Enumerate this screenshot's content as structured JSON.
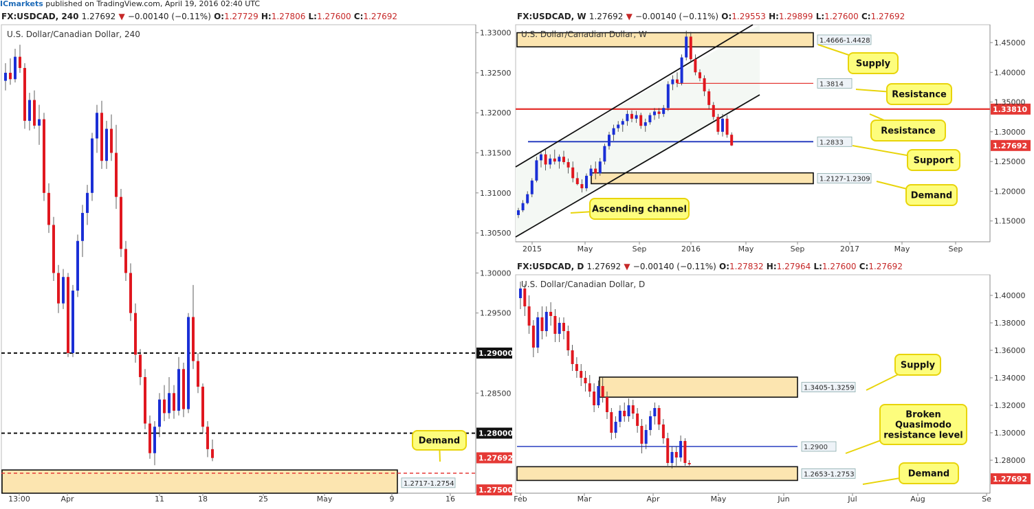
{
  "header": {
    "brand": "ICmarkets",
    "published": " published on TradingView.com, April 19, 2016 02:40 UTC"
  },
  "panels": {
    "h4": {
      "symbol": "FX:USDCAD, 240",
      "last": "1.27692",
      "change": "−0.00140 (−0.11%)",
      "o": "1.27729",
      "h": "1.27806",
      "l": "1.27600",
      "c": "1.27692",
      "chart_title": "U.S. Dollar/Canadian Dollar, 240"
    },
    "weekly": {
      "symbol": "FX:USDCAD, W",
      "last": "1.27692",
      "change": "−0.00140 (−0.11%)",
      "o": "1.29553",
      "h": "1.29899",
      "l": "1.27600",
      "c": "1.27692",
      "chart_title": "U.S. Dollar/Canadian Dollar, W"
    },
    "daily": {
      "symbol": "FX:USDCAD, D",
      "last": "1.27692",
      "change": "−0.00140 (−0.11%)",
      "o": "1.27832",
      "h": "1.27964",
      "l": "1.27600",
      "c": "1.27692",
      "chart_title": "U.S. Dollar/Canadian Dollar, D"
    }
  },
  "colors": {
    "up": "#1a2fd6",
    "down": "#e0171f",
    "zone_fill": "#fce5b0",
    "callout": "#fdfd7d",
    "callout_border": "#e8d40a",
    "res_line": "#e53935",
    "sup_line": "#283fc0"
  },
  "chart_data": [
    {
      "id": "h4",
      "type": "candlestick",
      "title": "U.S. Dollar/Canadian Dollar, 240",
      "ylim": [
        1.2725,
        1.331
      ],
      "y_ticks": [
        "1.33000",
        "1.32500",
        "1.32000",
        "1.31500",
        "1.31000",
        "1.30500",
        "1.30000",
        "1.29500",
        "1.29000",
        "1.28500",
        "1.28000",
        "1.27692",
        "1.27500"
      ],
      "x_ticks": [
        "13:00",
        "Apr",
        "11",
        "18",
        "25",
        "May",
        "9",
        "16"
      ],
      "ohlc": [
        [
          1.324,
          1.3262,
          1.3228,
          1.325
        ],
        [
          1.325,
          1.3268,
          1.3235,
          1.3242
        ],
        [
          1.3242,
          1.328,
          1.3238,
          1.327
        ],
        [
          1.327,
          1.3285,
          1.325,
          1.3256
        ],
        [
          1.3256,
          1.3262,
          1.318,
          1.319
        ],
        [
          1.319,
          1.3225,
          1.3178,
          1.3216
        ],
        [
          1.3216,
          1.3228,
          1.318,
          1.3184
        ],
        [
          1.3184,
          1.321,
          1.316,
          1.3192
        ],
        [
          1.3192,
          1.32,
          1.309,
          1.31
        ],
        [
          1.31,
          1.3112,
          1.305,
          1.306
        ],
        [
          1.306,
          1.307,
          1.299,
          1.3
        ],
        [
          1.3,
          1.301,
          1.295,
          1.2962
        ],
        [
          1.2962,
          1.3005,
          1.2955,
          1.2995
        ],
        [
          1.2995,
          1.3,
          1.2895,
          1.29
        ],
        [
          1.29,
          1.2985,
          1.2895,
          1.2978
        ],
        [
          1.2978,
          1.3048,
          1.297,
          1.304
        ],
        [
          1.304,
          1.3085,
          1.302,
          1.3075
        ],
        [
          1.3075,
          1.311,
          1.306,
          1.31
        ],
        [
          1.31,
          1.3175,
          1.309,
          1.3168
        ],
        [
          1.3168,
          1.321,
          1.315,
          1.32
        ],
        [
          1.32,
          1.3215,
          1.313,
          1.314
        ],
        [
          1.314,
          1.319,
          1.313,
          1.318
        ],
        [
          1.318,
          1.3198,
          1.314,
          1.315
        ],
        [
          1.315,
          1.3185,
          1.308,
          1.3095
        ],
        [
          1.3095,
          1.3105,
          1.302,
          1.303
        ],
        [
          1.303,
          1.304,
          1.299,
          1.3
        ],
        [
          1.3,
          1.3012,
          1.294,
          1.295
        ],
        [
          1.295,
          1.2962,
          1.2888,
          1.2898
        ],
        [
          1.2898,
          1.2905,
          1.286,
          1.287
        ],
        [
          1.287,
          1.288,
          1.2805,
          1.2812
        ],
        [
          1.2812,
          1.2822,
          1.2768,
          1.2775
        ],
        [
          1.2775,
          1.2815,
          1.276,
          1.2808
        ],
        [
          1.2808,
          1.285,
          1.2795,
          1.2842
        ],
        [
          1.2842,
          1.286,
          1.2815,
          1.2825
        ],
        [
          1.2825,
          1.287,
          1.2818,
          1.285
        ],
        [
          1.285,
          1.286,
          1.2818,
          1.2828
        ],
        [
          1.2828,
          1.2895,
          1.2822,
          1.288
        ],
        [
          1.288,
          1.2888,
          1.282,
          1.283
        ],
        [
          1.283,
          1.295,
          1.2825,
          1.2945
        ],
        [
          1.2945,
          1.2985,
          1.288,
          1.289
        ],
        [
          1.289,
          1.29,
          1.285,
          1.2858
        ],
        [
          1.2858,
          1.2862,
          1.28,
          1.2808
        ],
        [
          1.2808,
          1.2815,
          1.277,
          1.278
        ],
        [
          1.278,
          1.2792,
          1.2765,
          1.2769
        ]
      ],
      "levels": [
        {
          "price": 1.29,
          "label": "1.29000",
          "style": "dashed"
        },
        {
          "price": 1.28,
          "label": "1.28000",
          "style": "dashed"
        },
        {
          "price": 1.275,
          "label": "1.27500",
          "style": "dashed-red"
        }
      ],
      "zones": [
        {
          "from": 1.2717,
          "to": 1.2754,
          "label": "1.2717-1.2754"
        }
      ],
      "callouts": [
        "Demand"
      ]
    },
    {
      "id": "weekly",
      "type": "candlestick",
      "title": "U.S. Dollar/Canadian Dollar, W",
      "ylim": [
        1.115,
        1.48
      ],
      "y_ticks": [
        "1.45000",
        "1.40000",
        "1.35000",
        "1.30000",
        "1.25000",
        "1.20000",
        "1.15000"
      ],
      "price_labels": [
        "1.33810",
        "1.27692"
      ],
      "x_ticks": [
        "2015",
        "May",
        "Sep",
        "2016",
        "May",
        "Sep",
        "2017",
        "May",
        "Sep"
      ],
      "ohlc": [
        [
          1.16,
          1.172,
          1.155,
          1.168
        ],
        [
          1.168,
          1.185,
          1.165,
          1.18
        ],
        [
          1.18,
          1.2,
          1.178,
          1.195
        ],
        [
          1.195,
          1.222,
          1.19,
          1.218
        ],
        [
          1.218,
          1.258,
          1.215,
          1.252
        ],
        [
          1.252,
          1.268,
          1.24,
          1.262
        ],
        [
          1.262,
          1.27,
          1.235,
          1.245
        ],
        [
          1.245,
          1.262,
          1.238,
          1.255
        ],
        [
          1.255,
          1.27,
          1.245,
          1.25
        ],
        [
          1.25,
          1.262,
          1.238,
          1.258
        ],
        [
          1.258,
          1.268,
          1.245,
          1.249
        ],
        [
          1.249,
          1.255,
          1.23,
          1.24
        ],
        [
          1.24,
          1.25,
          1.215,
          1.222
        ],
        [
          1.222,
          1.232,
          1.21,
          1.212
        ],
        [
          1.212,
          1.22,
          1.198,
          1.205
        ],
        [
          1.205,
          1.23,
          1.2,
          1.226
        ],
        [
          1.226,
          1.244,
          1.22,
          1.238
        ],
        [
          1.238,
          1.25,
          1.22,
          1.23
        ],
        [
          1.23,
          1.256,
          1.226,
          1.25
        ],
        [
          1.25,
          1.28,
          1.245,
          1.276
        ],
        [
          1.276,
          1.3,
          1.27,
          1.295
        ],
        [
          1.295,
          1.312,
          1.285,
          1.306
        ],
        [
          1.306,
          1.318,
          1.3,
          1.312
        ],
        [
          1.312,
          1.322,
          1.3,
          1.318
        ],
        [
          1.318,
          1.336,
          1.31,
          1.33
        ],
        [
          1.33,
          1.336,
          1.316,
          1.322
        ],
        [
          1.322,
          1.335,
          1.315,
          1.328
        ],
        [
          1.328,
          1.332,
          1.305,
          1.31
        ],
        [
          1.31,
          1.322,
          1.3,
          1.316
        ],
        [
          1.316,
          1.332,
          1.312,
          1.328
        ],
        [
          1.328,
          1.34,
          1.32,
          1.334
        ],
        [
          1.334,
          1.34,
          1.322,
          1.33
        ],
        [
          1.33,
          1.345,
          1.325,
          1.34
        ],
        [
          1.34,
          1.385,
          1.335,
          1.38
        ],
        [
          1.38,
          1.395,
          1.37,
          1.388
        ],
        [
          1.388,
          1.4,
          1.375,
          1.382
        ],
        [
          1.382,
          1.43,
          1.378,
          1.425
        ],
        [
          1.425,
          1.47,
          1.42,
          1.46
        ],
        [
          1.46,
          1.468,
          1.418,
          1.422
        ],
        [
          1.422,
          1.43,
          1.395,
          1.4
        ],
        [
          1.4,
          1.405,
          1.385,
          1.39
        ],
        [
          1.39,
          1.395,
          1.36,
          1.368
        ],
        [
          1.368,
          1.372,
          1.338,
          1.345
        ],
        [
          1.345,
          1.35,
          1.32,
          1.325
        ],
        [
          1.325,
          1.33,
          1.295,
          1.3
        ],
        [
          1.3,
          1.33,
          1.292,
          1.322
        ],
        [
          1.322,
          1.328,
          1.29,
          1.295
        ],
        [
          1.295,
          1.299,
          1.276,
          1.277
        ]
      ],
      "levels": [
        {
          "price": 1.3814,
          "label": "1.3814",
          "style": "res"
        },
        {
          "price": 1.3381,
          "label": "1.33810",
          "style": "res-thick"
        },
        {
          "price": 1.2833,
          "label": "1.2833",
          "style": "support"
        }
      ],
      "zones": [
        {
          "from": 1.4428,
          "to": 1.4666,
          "label": "1.4666-1.4428"
        },
        {
          "from": 1.2127,
          "to": 1.2309,
          "label": "1.2127-1.2309"
        }
      ],
      "callouts": [
        "Supply",
        "Resistance",
        "Resistance",
        "Support",
        "Demand",
        "Ascending channel"
      ]
    },
    {
      "id": "daily",
      "type": "candlestick",
      "title": "U.S. Dollar/Canadian Dollar, D",
      "ylim": [
        1.256,
        1.415
      ],
      "y_ticks": [
        "1.40000",
        "1.38000",
        "1.36000",
        "1.34000",
        "1.32000",
        "1.30000",
        "1.28000"
      ],
      "price_labels": [
        "1.27692"
      ],
      "x_ticks": [
        "Feb",
        "Mar",
        "Apr",
        "May",
        "Jun",
        "Jul",
        "Aug",
        "Se"
      ],
      "ohlc": [
        [
          1.398,
          1.41,
          1.39,
          1.405
        ],
        [
          1.405,
          1.408,
          1.385,
          1.392
        ],
        [
          1.392,
          1.4,
          1.372,
          1.378
        ],
        [
          1.378,
          1.382,
          1.355,
          1.362
        ],
        [
          1.362,
          1.388,
          1.358,
          1.384
        ],
        [
          1.384,
          1.392,
          1.368,
          1.374
        ],
        [
          1.374,
          1.392,
          1.37,
          1.388
        ],
        [
          1.388,
          1.395,
          1.378,
          1.385
        ],
        [
          1.385,
          1.39,
          1.366,
          1.372
        ],
        [
          1.372,
          1.384,
          1.366,
          1.38
        ],
        [
          1.38,
          1.384,
          1.368,
          1.374
        ],
        [
          1.374,
          1.378,
          1.356,
          1.36
        ],
        [
          1.36,
          1.364,
          1.345,
          1.35
        ],
        [
          1.35,
          1.355,
          1.34,
          1.345
        ],
        [
          1.345,
          1.35,
          1.334,
          1.34
        ],
        [
          1.34,
          1.345,
          1.33,
          1.336
        ],
        [
          1.336,
          1.342,
          1.326,
          1.33
        ],
        [
          1.33,
          1.336,
          1.315,
          1.32
        ],
        [
          1.32,
          1.338,
          1.318,
          1.334
        ],
        [
          1.334,
          1.34,
          1.322,
          1.326
        ],
        [
          1.326,
          1.33,
          1.31,
          1.315
        ],
        [
          1.315,
          1.318,
          1.295,
          1.3
        ],
        [
          1.3,
          1.312,
          1.296,
          1.308
        ],
        [
          1.308,
          1.32,
          1.304,
          1.316
        ],
        [
          1.316,
          1.322,
          1.308,
          1.312
        ],
        [
          1.312,
          1.325,
          1.308,
          1.32
        ],
        [
          1.32,
          1.324,
          1.31,
          1.314
        ],
        [
          1.314,
          1.318,
          1.3,
          1.305
        ],
        [
          1.305,
          1.31,
          1.285,
          1.292
        ],
        [
          1.292,
          1.306,
          1.288,
          1.302
        ],
        [
          1.302,
          1.316,
          1.298,
          1.312
        ],
        [
          1.312,
          1.322,
          1.306,
          1.318
        ],
        [
          1.318,
          1.32,
          1.302,
          1.306
        ],
        [
          1.306,
          1.31,
          1.292,
          1.296
        ],
        [
          1.296,
          1.3,
          1.276,
          1.278
        ],
        [
          1.278,
          1.29,
          1.274,
          1.286
        ],
        [
          1.286,
          1.29,
          1.276,
          1.282
        ],
        [
          1.282,
          1.298,
          1.279,
          1.294
        ],
        [
          1.294,
          1.296,
          1.276,
          1.278
        ],
        [
          1.278,
          1.28,
          1.276,
          1.277
        ]
      ],
      "levels": [
        {
          "price": 1.29,
          "label": "1.2900",
          "style": "support"
        }
      ],
      "zones": [
        {
          "from": 1.3259,
          "to": 1.3405,
          "label": "1.3405-1.3259"
        },
        {
          "from": 1.2653,
          "to": 1.2753,
          "label": "1.2653-1.2753"
        }
      ],
      "callouts": [
        "Supply",
        "Broken Quasimodo resistance level",
        "Demand"
      ]
    }
  ]
}
